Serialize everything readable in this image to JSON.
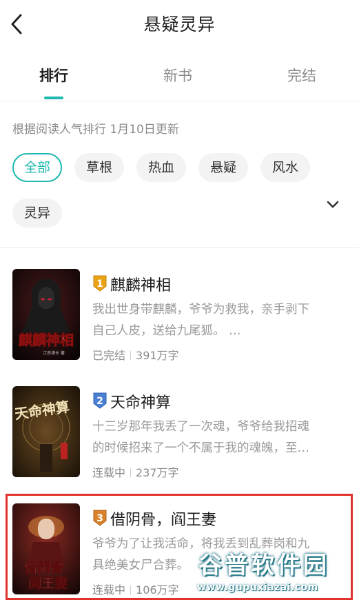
{
  "header": {
    "title": "悬疑灵异"
  },
  "tabs": [
    {
      "label": "排行",
      "active": true
    },
    {
      "label": "新书",
      "active": false
    },
    {
      "label": "完结",
      "active": false
    }
  ],
  "subtitle": "根据阅读人气排行 1月10日更新",
  "filters": [
    {
      "label": "全部",
      "active": true
    },
    {
      "label": "草根",
      "active": false
    },
    {
      "label": "热血",
      "active": false
    },
    {
      "label": "悬疑",
      "active": false
    },
    {
      "label": "风水",
      "active": false
    },
    {
      "label": "灵异",
      "active": false
    }
  ],
  "books": [
    {
      "rank": "1",
      "title": "麒麟神相",
      "desc_line1": "我出世身带麒麟，爷爷为救我，亲手剥下",
      "desc_line2": "自己人皮，送给九尾狐。 …",
      "status": "已完结",
      "words": "391万字",
      "cover_text": "麒麟神相",
      "cover_author": "江南诸长 著"
    },
    {
      "rank": "2",
      "title": "天命神算",
      "desc_line1": "十三岁那年我丢了一次魂，爷爷给我招魂",
      "desc_line2": "的时候招来了一个不属于我的魂魄，至…",
      "status": "连载中",
      "words": "237万字",
      "cover_text": "天命神算"
    },
    {
      "rank": "3",
      "title": "借阴骨，阎王妻",
      "desc_line1": "爷爷为了让我活命，将我丢到乱葬岗和九",
      "desc_line2": "具绝美女尸合葬。",
      "status": "连载中",
      "words": "106万字",
      "cover_text_1": "借阴骨",
      "cover_text_2": "阎王妻"
    }
  ],
  "watermark": {
    "name": "谷普软件园",
    "url": "www.gupuxiazai.com"
  },
  "colors": {
    "accent": "#1fb8b0",
    "highlight": "#e0332e",
    "rank1": "#e8a317",
    "rank2": "#4a7fd4",
    "rank3": "#d9822b"
  }
}
